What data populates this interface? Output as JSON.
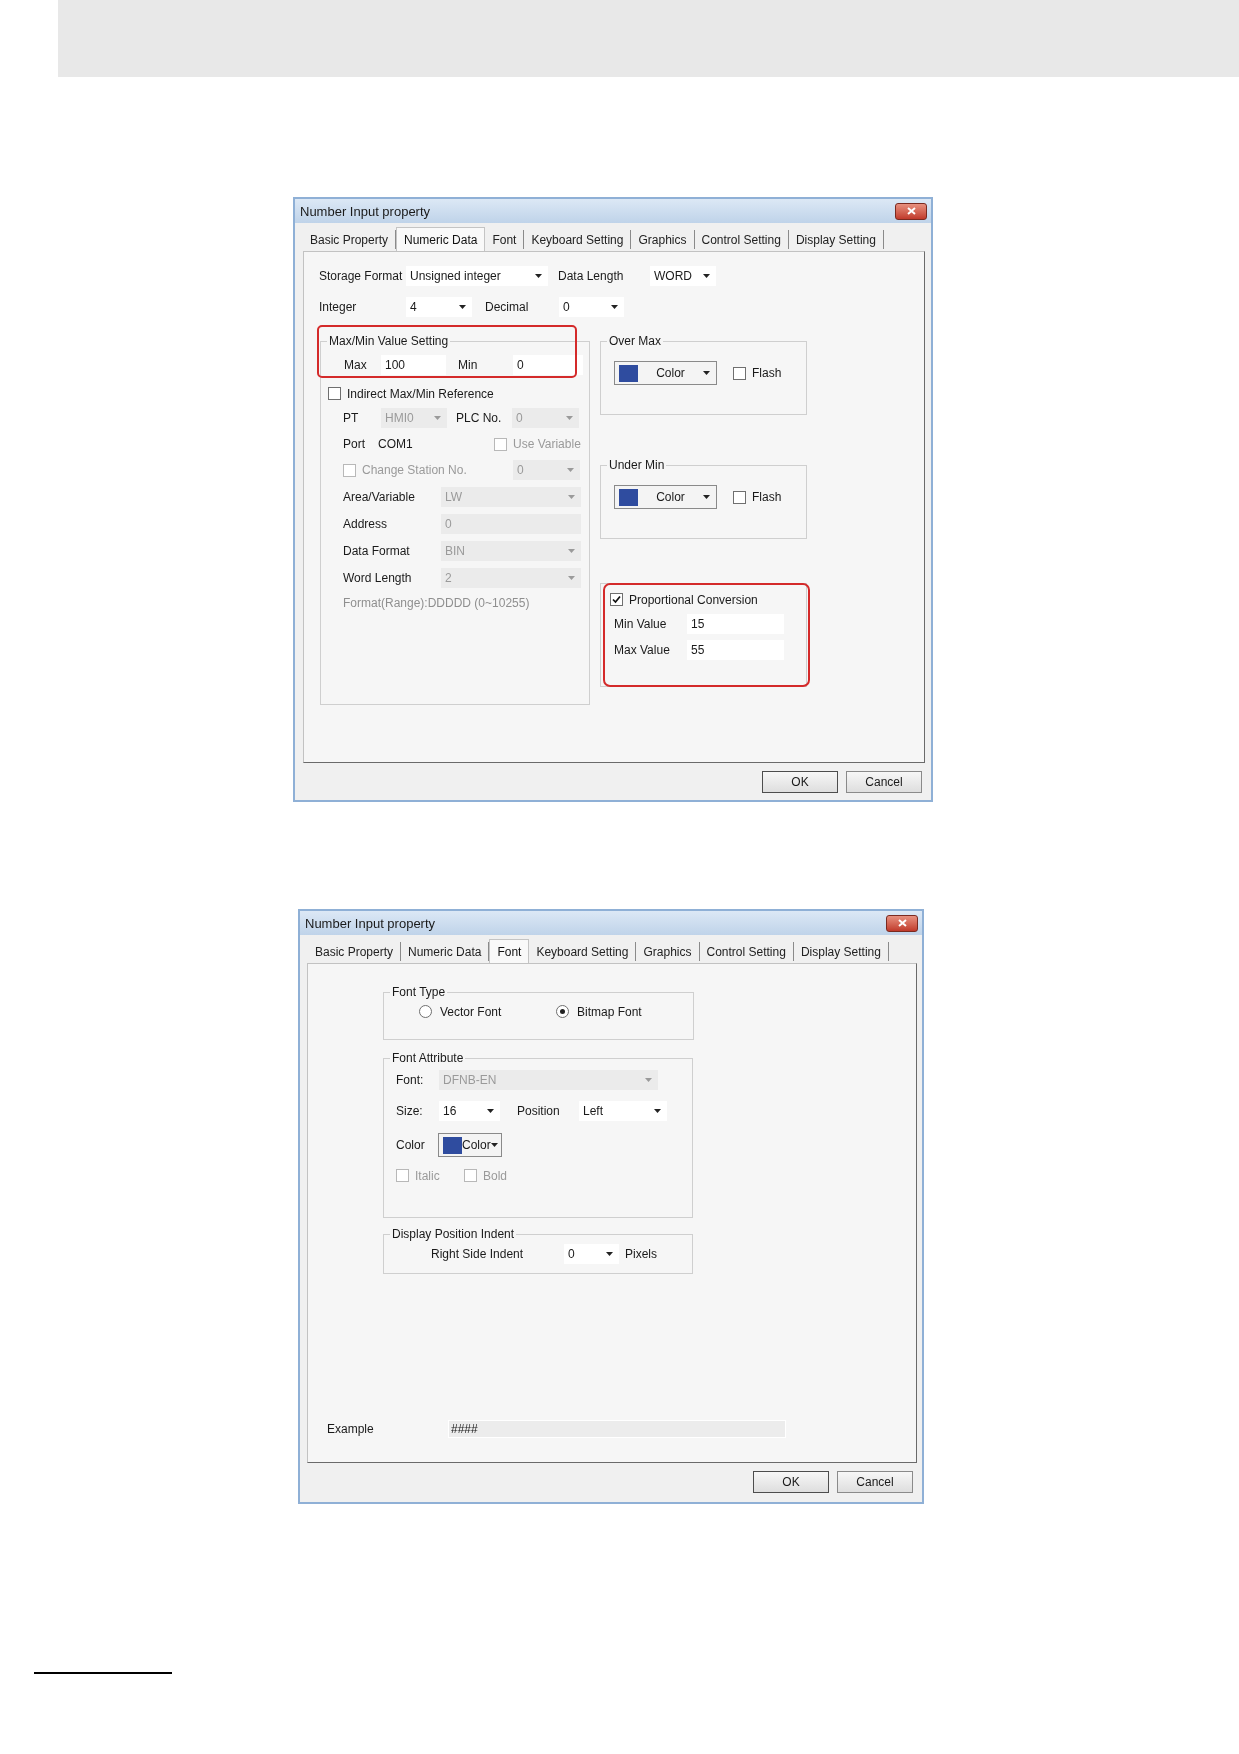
{
  "dialogs": [
    {
      "kind": "numeric_data",
      "title": "Number Input property",
      "tabs": [
        {
          "label": "Basic Property",
          "selected": false
        },
        {
          "label": "Numeric Data",
          "selected": true
        },
        {
          "label": "Font",
          "selected": false
        },
        {
          "label": "Keyboard Setting",
          "selected": false
        },
        {
          "label": "Graphics",
          "selected": false
        },
        {
          "label": "Control Setting",
          "selected": false
        },
        {
          "label": "Display Setting",
          "selected": false
        }
      ],
      "storage_format": {
        "label": "Storage Format",
        "value": "Unsigned integer"
      },
      "data_length": {
        "label": "Data Length",
        "value": "WORD"
      },
      "integer": {
        "label": "Integer",
        "value": "4"
      },
      "decimal": {
        "label": "Decimal",
        "value": "0"
      },
      "max_min": {
        "title": "Max/Min Value Setting",
        "highlighted": true,
        "max_label": "Max",
        "max_value": "100",
        "min_label": "Min",
        "min_value": "0"
      },
      "indirect": {
        "label": "Indirect Max/Min Reference",
        "checked": false,
        "pt_label": "PT",
        "pt_value": "HMI0",
        "plc_label": "PLC No.",
        "plc_value": "0",
        "port_label": "Port",
        "port_value": "COM1",
        "use_variable": {
          "label": "Use Variable",
          "checked": false
        },
        "change_station": {
          "label": "Change Station No.",
          "checked": false,
          "value": "0"
        },
        "fields": [
          {
            "label": "Area/Variable",
            "value": "LW",
            "kind": "select"
          },
          {
            "label": "Address",
            "value": "0",
            "kind": "text"
          },
          {
            "label": "Data Format",
            "value": "BIN",
            "kind": "select"
          },
          {
            "label": "Word Length",
            "value": "2",
            "kind": "select"
          }
        ],
        "format_range": "Format(Range):DDDDD (0~10255)"
      },
      "over_max": {
        "title": "Over Max",
        "color": "#2f4c9f",
        "color_label": "Color",
        "flash": {
          "label": "Flash",
          "checked": false
        }
      },
      "under_min": {
        "title": "Under Min",
        "color": "#2f4c9f",
        "color_label": "Color",
        "flash": {
          "label": "Flash",
          "checked": false
        }
      },
      "proportional": {
        "label": "Proportional Conversion",
        "checked": true,
        "highlighted": true,
        "min_label": "Min Value",
        "min_value": "15",
        "max_label": "Max Value",
        "max_value": "55"
      },
      "buttons": [
        "OK",
        "Cancel"
      ]
    },
    {
      "kind": "font",
      "title": "Number Input property",
      "tabs": [
        {
          "label": "Basic Property",
          "selected": false
        },
        {
          "label": "Numeric Data",
          "selected": false
        },
        {
          "label": "Font",
          "selected": true
        },
        {
          "label": "Keyboard Setting",
          "selected": false
        },
        {
          "label": "Graphics",
          "selected": false
        },
        {
          "label": "Control Setting",
          "selected": false
        },
        {
          "label": "Display Setting",
          "selected": false
        }
      ],
      "font_type": {
        "title": "Font Type",
        "options": [
          {
            "label": "Vector Font",
            "selected": false
          },
          {
            "label": "Bitmap Font",
            "selected": true
          }
        ]
      },
      "font_attribute": {
        "title": "Font Attribute",
        "font": {
          "label": "Font:",
          "value": "DFNB-EN",
          "disabled": true
        },
        "size": {
          "label": "Size:",
          "value": "16"
        },
        "position": {
          "label": "Position",
          "value": "Left"
        },
        "color": {
          "label": "Color",
          "button": "Color",
          "color": "#2f4c9f"
        },
        "styles": [
          {
            "label": "Italic",
            "checked": false,
            "disabled": true
          },
          {
            "label": "Bold",
            "checked": false,
            "disabled": true
          }
        ]
      },
      "indent": {
        "title": "Display Position Indent",
        "label": "Right Side Indent",
        "value": "0",
        "unit": "Pixels"
      },
      "example": {
        "label": "Example",
        "value": "####"
      },
      "buttons": [
        "OK",
        "Cancel"
      ]
    }
  ]
}
